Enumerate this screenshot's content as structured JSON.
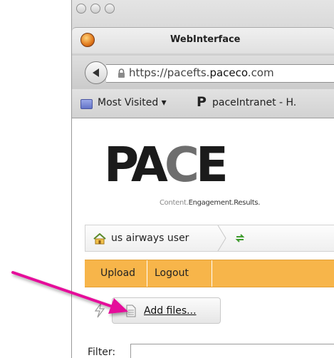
{
  "window": {
    "title": "WebInterface"
  },
  "address_bar": {
    "url_prefix": "https://pacefts.",
    "url_domain": "paceco",
    "url_suffix": ".com"
  },
  "bookmarks": {
    "most_visited_label": "Most Visited",
    "intranet_label": "paceIntranet - H."
  },
  "logo": {
    "letters_pa": "PA",
    "letter_c": "C",
    "letter_e": "E",
    "tagline_1": "Content.",
    "tagline_2": "Engagement.",
    "tagline_3": "Results."
  },
  "breadcrumb": {
    "user_label": "us airways user"
  },
  "menu": {
    "upload_label": "Upload",
    "logout_label": "Logout"
  },
  "toolbar": {
    "add_files_label": "Add files..."
  },
  "filter": {
    "label": "Filter:",
    "value": ""
  },
  "colors": {
    "menubar": "#f7b54a",
    "annotation_arrow": "#e5119a"
  }
}
